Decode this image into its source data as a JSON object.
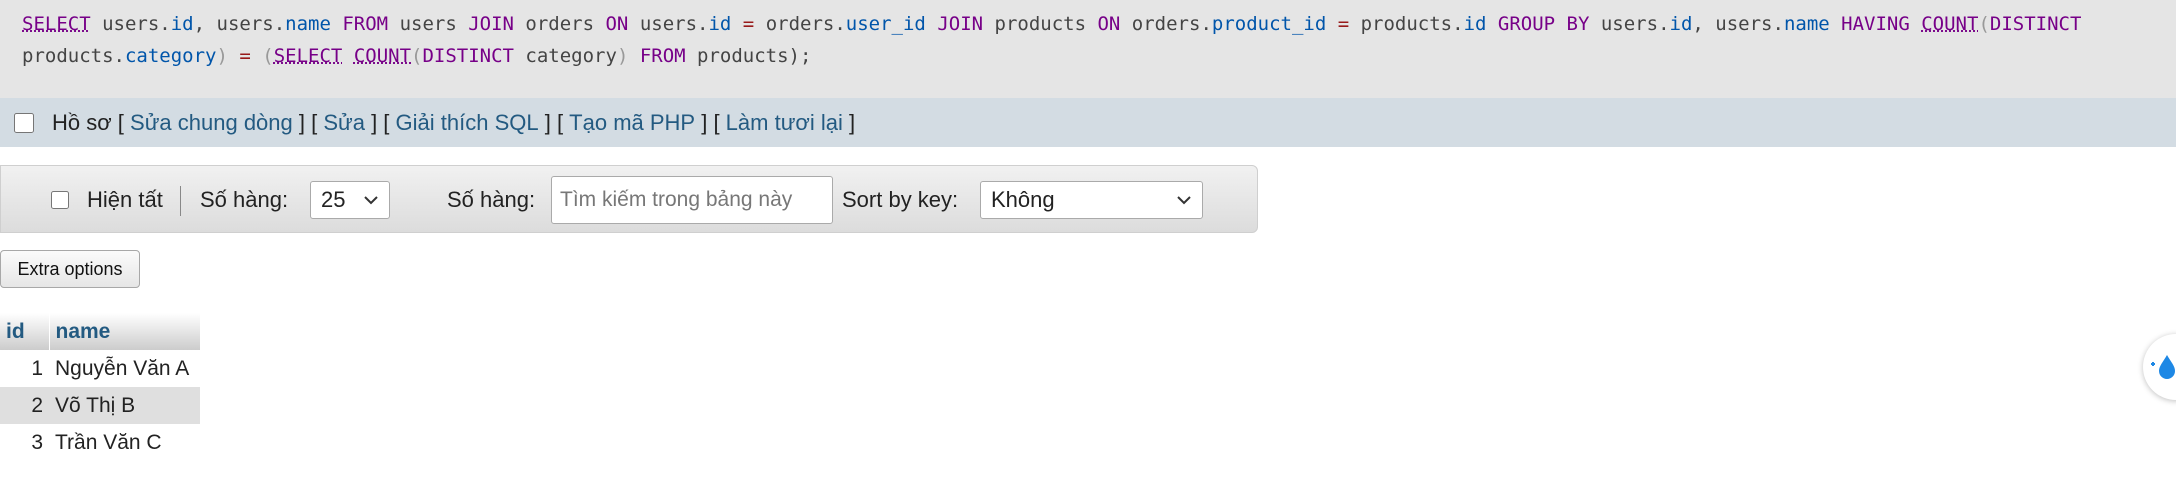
{
  "sql": {
    "line1": [
      {
        "t": "SELECT",
        "c": "fn"
      },
      {
        "t": " users",
        "c": ""
      },
      {
        "t": ".",
        "c": ""
      },
      {
        "t": "id",
        "c": "fld"
      },
      {
        "t": ", users",
        "c": ""
      },
      {
        "t": ".",
        "c": ""
      },
      {
        "t": "name",
        "c": "fld"
      },
      {
        "t": " FROM",
        "c": "kw"
      },
      {
        "t": " users ",
        "c": ""
      },
      {
        "t": "JOIN",
        "c": "kw"
      },
      {
        "t": " orders ",
        "c": ""
      },
      {
        "t": "ON",
        "c": "kw"
      },
      {
        "t": " users",
        "c": ""
      },
      {
        "t": ".",
        "c": ""
      },
      {
        "t": "id",
        "c": "fld"
      },
      {
        "t": " = ",
        "c": "op"
      },
      {
        "t": "orders",
        "c": ""
      },
      {
        "t": ".",
        "c": ""
      },
      {
        "t": "user_id",
        "c": "fld"
      },
      {
        "t": " ",
        "c": ""
      },
      {
        "t": "JOIN",
        "c": "kw"
      },
      {
        "t": " products ",
        "c": ""
      },
      {
        "t": "ON",
        "c": "kw"
      },
      {
        "t": " orders",
        "c": ""
      },
      {
        "t": ".",
        "c": ""
      },
      {
        "t": "product_id",
        "c": "fld"
      },
      {
        "t": " = ",
        "c": "op"
      },
      {
        "t": "products",
        "c": ""
      },
      {
        "t": ".",
        "c": ""
      },
      {
        "t": "id",
        "c": "fld"
      },
      {
        "t": " GROUP BY",
        "c": "kw"
      },
      {
        "t": " users",
        "c": ""
      },
      {
        "t": ".",
        "c": ""
      },
      {
        "t": "id",
        "c": "fld"
      },
      {
        "t": ", users",
        "c": ""
      },
      {
        "t": ".",
        "c": ""
      },
      {
        "t": "name",
        "c": "fld"
      },
      {
        "t": " HAVING",
        "c": "kw"
      },
      {
        "t": " ",
        "c": ""
      },
      {
        "t": "COUNT",
        "c": "fn"
      },
      {
        "t": "(",
        "c": "br"
      },
      {
        "t": "DISTINCT",
        "c": "kw"
      }
    ],
    "line2": [
      {
        "t": "products",
        "c": ""
      },
      {
        "t": ".",
        "c": ""
      },
      {
        "t": "category",
        "c": "fld"
      },
      {
        "t": ")",
        "c": "br"
      },
      {
        "t": " = ",
        "c": "op"
      },
      {
        "t": "(",
        "c": "br"
      },
      {
        "t": "SELECT",
        "c": "fn"
      },
      {
        "t": " ",
        "c": ""
      },
      {
        "t": "COUNT",
        "c": "fn"
      },
      {
        "t": "(",
        "c": "br"
      },
      {
        "t": "DISTINCT",
        "c": "kw"
      },
      {
        "t": " category",
        "c": ""
      },
      {
        "t": ")",
        "c": "br"
      },
      {
        "t": " FROM",
        "c": "kw"
      },
      {
        "t": " products",
        "c": ""
      },
      {
        "t": ");",
        "c": ""
      }
    ]
  },
  "links_bar": {
    "profile_label": "Hồ sơ",
    "links": [
      "Sửa chung dòng",
      "Sửa",
      "Giải thích SQL",
      "Tạo mã PHP",
      "Làm tươi lại"
    ]
  },
  "nav": {
    "show_all_label": "Hiện tất",
    "rows_label": "Số hàng:",
    "rows_value": "25",
    "filter_label": "Số hàng:",
    "search_placeholder": "Tìm kiếm trong bảng này",
    "sort_label": "Sort by key:",
    "sort_value": "Không"
  },
  "extra_options_label": "Extra options",
  "table": {
    "columns": [
      "id",
      "name"
    ],
    "rows": [
      {
        "id": "1",
        "name": "Nguyễn Văn A"
      },
      {
        "id": "2",
        "name": "Võ Thị B"
      },
      {
        "id": "3",
        "name": "Trần Văn C"
      }
    ]
  },
  "icons": {
    "float_widget": "translate-drop-icon",
    "select_chevron": "chevron-down-icon"
  },
  "colors": {
    "link": "#235a81",
    "links_bar_bg": "#d3dce3",
    "sql_bg": "#e5e5e5",
    "keyword": "#770088",
    "field": "#0055aa"
  }
}
